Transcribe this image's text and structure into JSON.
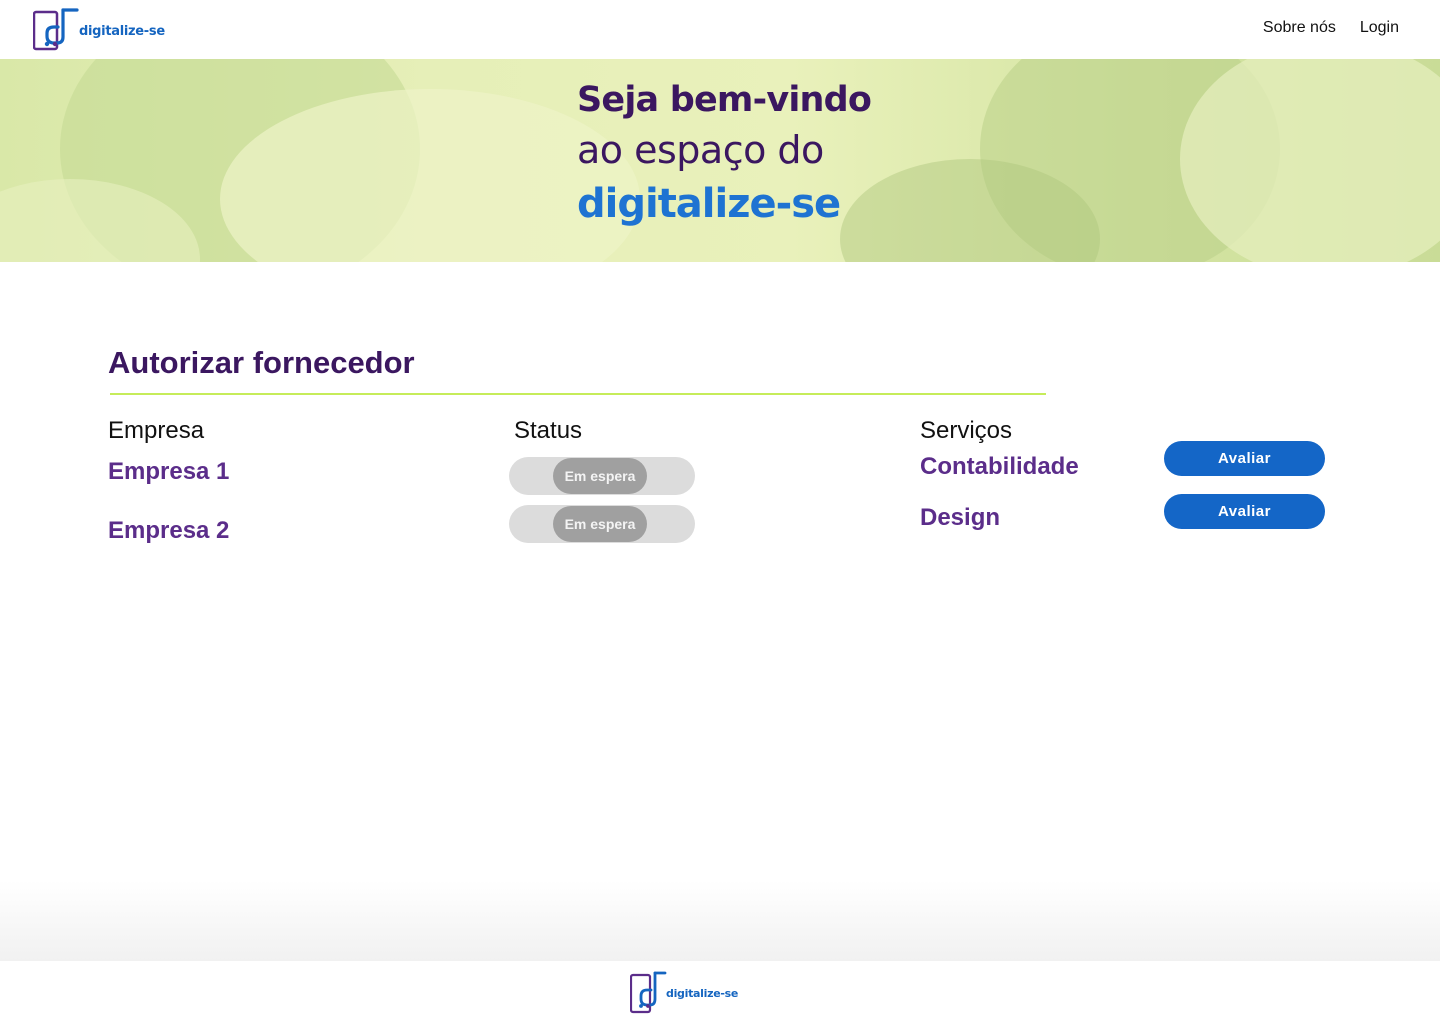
{
  "brand": {
    "name": "digitalize-se",
    "purple": "#5b2d8a",
    "blue": "#1565c0",
    "accent_green": "#c6ec5a"
  },
  "nav": {
    "items": [
      {
        "label": "Sobre nós"
      },
      {
        "label": "Login"
      }
    ]
  },
  "hero": {
    "line1": "Seja bem-vindo",
    "line2": "ao espaço do",
    "line3": "digitalize-se"
  },
  "section": {
    "title_regular": "Autorizar",
    "title_bold": "fornecedor"
  },
  "table": {
    "headers": {
      "company": "Empresa",
      "status": "Status",
      "services": "Serviços"
    },
    "companies": [
      {
        "name": "Empresa 1",
        "status": "Em espera"
      },
      {
        "name": "Empresa 2",
        "status": "Em espera"
      }
    ],
    "services": [
      {
        "name": "Contabilidade",
        "action": "Avaliar"
      },
      {
        "name": "Design",
        "action": "Avaliar"
      }
    ]
  },
  "footer": {
    "logo_text": "digitalize-se"
  }
}
